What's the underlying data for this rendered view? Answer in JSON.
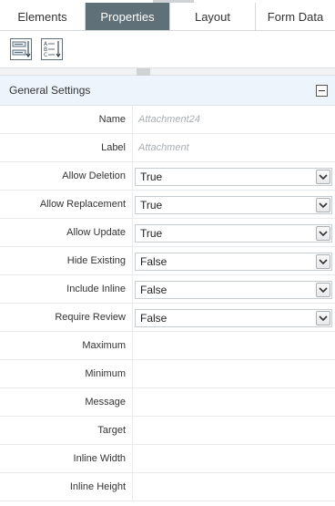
{
  "tabs": [
    {
      "label": "Elements",
      "active": false
    },
    {
      "label": "Properties",
      "active": true
    },
    {
      "label": "Layout",
      "active": false
    },
    {
      "label": "Form Data",
      "active": false
    }
  ],
  "toolbar": {
    "buttons": [
      {
        "icon": "categorized-view-icon"
      },
      {
        "icon": "alphabetical-sort-icon"
      }
    ]
  },
  "section": {
    "title": "General Settings",
    "collapse_icon": "collapse-icon"
  },
  "properties": [
    {
      "label": "Name",
      "placeholder": "Attachment24"
    },
    {
      "label": "Label",
      "placeholder": "Attachment"
    },
    {
      "label": "Allow Deletion",
      "value": "True"
    },
    {
      "label": "Allow Replacement",
      "value": "True"
    },
    {
      "label": "Allow Update",
      "value": "True"
    },
    {
      "label": "Hide Existing",
      "value": "False"
    },
    {
      "label": "Include Inline",
      "value": "False"
    },
    {
      "label": "Require Review",
      "value": "False"
    },
    {
      "label": "Maximum"
    },
    {
      "label": "Minimum"
    },
    {
      "label": "Message"
    },
    {
      "label": "Target"
    },
    {
      "label": "Inline Width"
    },
    {
      "label": "Inline Height"
    }
  ],
  "colors": {
    "active_tab": "#5f7079",
    "section_header": "#eef4fb",
    "placeholder_text": "#a8aeb3"
  }
}
